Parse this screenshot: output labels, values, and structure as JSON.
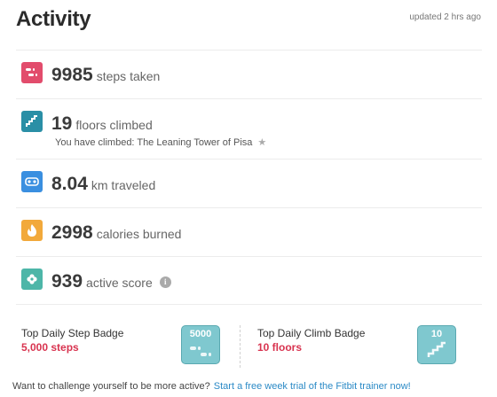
{
  "header": {
    "title": "Activity",
    "updated": "updated 2 hrs ago"
  },
  "colors": {
    "steps": "#e24c6c",
    "floors": "#2a8fa6",
    "distance": "#3a8fe0",
    "calories": "#f2a93b",
    "score": "#4db6a8",
    "badge_highlight": "#d8334f",
    "link": "#2b8ac6"
  },
  "metrics": [
    {
      "icon": "footsteps-icon",
      "value": "9985",
      "unit": "steps taken"
    },
    {
      "icon": "stairs-icon",
      "value": "19",
      "unit": "floors climbed",
      "sub": "You have climbed: The Leaning Tower of Pisa"
    },
    {
      "icon": "distance-icon",
      "value": "8.04",
      "unit": "km traveled"
    },
    {
      "icon": "flame-icon",
      "value": "2998",
      "unit": "calories burned"
    },
    {
      "icon": "flower-icon",
      "value": "939",
      "unit": "active score"
    }
  ],
  "badges": [
    {
      "label": "Top Daily Step Badge",
      "value": "5,000 steps",
      "badge_text": "5000",
      "icon": "step-badge-icon"
    },
    {
      "label": "Top Daily Climb Badge",
      "value": "10 floors",
      "badge_text": "10",
      "icon": "climb-badge-icon"
    }
  ],
  "footer": {
    "prompt": "Want to challenge yourself to be more active?",
    "link": "Start a free week trial of the Fitbit trainer now!"
  }
}
